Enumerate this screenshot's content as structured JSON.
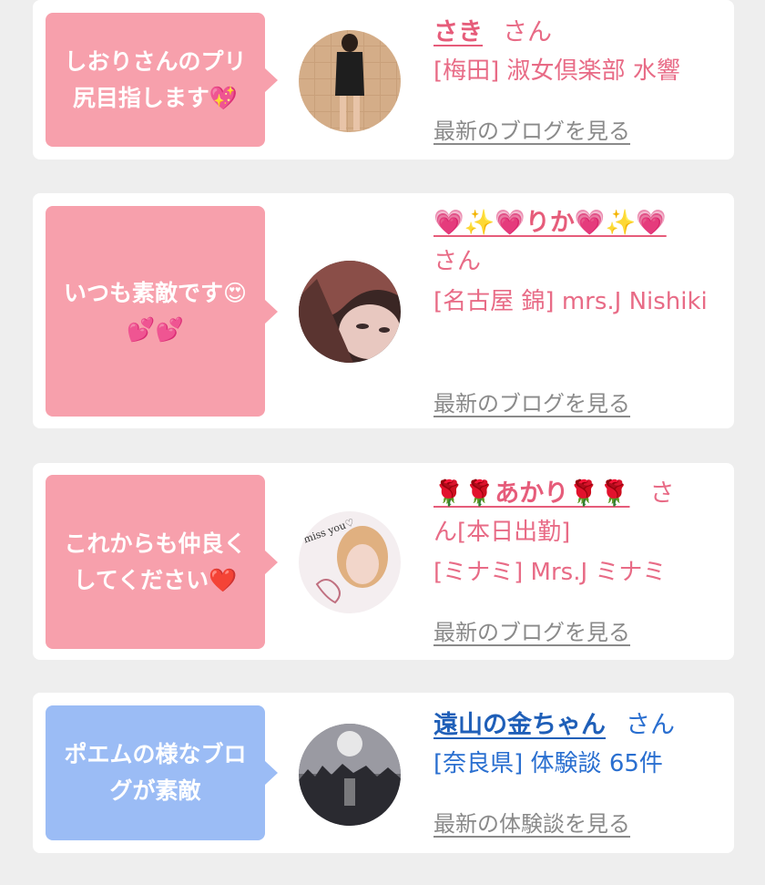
{
  "cards": [
    {
      "comment": "しおりさんのプリ\n尻目指します💖",
      "name": "さき",
      "honorific": "さん",
      "detail": "[梅田] 淑女倶楽部 水響",
      "link": "最新のブログを見る"
    },
    {
      "comment": "いつも素敵です😍\n💕💕",
      "name": "💗✨💗りか💗✨💗",
      "honorific": "さん",
      "detail": "[名古屋 錦] mrs.J Nishiki",
      "link": "最新のブログを見る"
    },
    {
      "comment": "これからも仲良く\nしてください❤️",
      "name": "🌹🌹あかり🌹🌹",
      "honorific": "さ",
      "detail": "ん[本日出勤]",
      "detail2": "[ミナミ] Mrs.J ミナミ",
      "link": "最新のブログを見る",
      "avatar_text": "miss you♡"
    },
    {
      "comment": "ポエムの様なブロ\nグが素敵",
      "name": "遠山の金ちゃん",
      "honorific": "さん",
      "detail": "[奈良県] 体験談 65件",
      "link": "最新の体験談を見る"
    }
  ],
  "colors": {
    "pink_bubble": "#f7a0ac",
    "blue_bubble": "#9bbcf5",
    "pink_text": "#e86b86",
    "blue_text": "#1f5fb8"
  }
}
